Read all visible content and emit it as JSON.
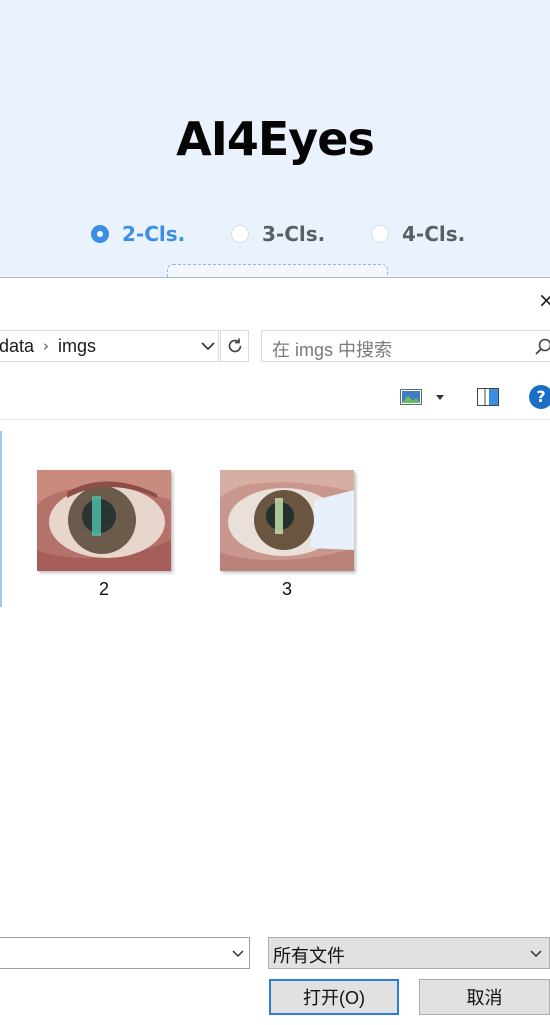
{
  "app": {
    "title": "AI4Eyes",
    "classes": [
      {
        "label": "2-Cls.",
        "selected": true
      },
      {
        "label": "3-Cls.",
        "selected": false
      },
      {
        "label": "4-Cls.",
        "selected": false
      }
    ],
    "accent_color": "#3a8ee6"
  },
  "dialog": {
    "close_glyph": "×",
    "breadcrumb": [
      "data",
      "imgs"
    ],
    "breadcrumb_separator": "›",
    "search_placeholder": "在 imgs 中搜索",
    "help_glyph": "?",
    "files": [
      {
        "name": "2"
      },
      {
        "name": "3"
      }
    ],
    "filename_value": "",
    "file_type_filter": "所有文件",
    "open_button": "打开(O)",
    "cancel_button": "取消"
  }
}
